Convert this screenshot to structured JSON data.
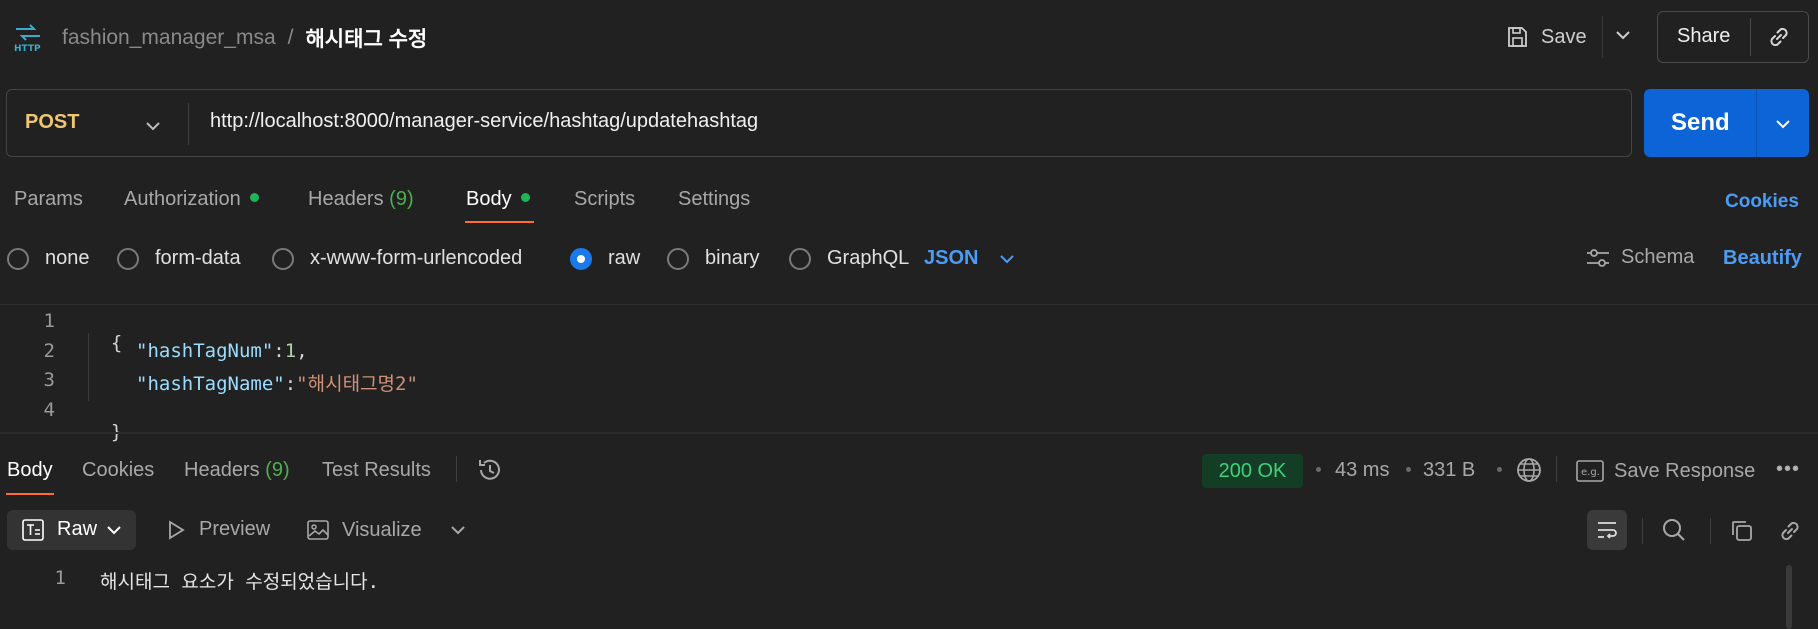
{
  "header": {
    "collection": "fashion_manager_msa",
    "separator": "/",
    "request_name": "해시태그 수정",
    "save_label": "Save",
    "share_label": "Share"
  },
  "request": {
    "method": "POST",
    "url": "http://localhost:8000/manager-service/hashtag/updatehashtag",
    "send_label": "Send"
  },
  "request_tabs": [
    {
      "label": "Params"
    },
    {
      "label": "Authorization"
    },
    {
      "label": "Headers",
      "count": "(9)"
    },
    {
      "label": "Body"
    },
    {
      "label": "Scripts"
    },
    {
      "label": "Settings"
    }
  ],
  "cookies_label": "Cookies",
  "body_types": [
    "none",
    "form-data",
    "x-www-form-urlencoded",
    "raw",
    "binary",
    "GraphQL"
  ],
  "body_type_selected": "raw",
  "body_format": "JSON",
  "schema_label": "Schema",
  "beautify_label": "Beautify",
  "editor": {
    "line_numbers": [
      "1",
      "2",
      "3",
      "4"
    ],
    "open_brace": "{",
    "close_brace": "}",
    "key1": "\"hashTagNum\"",
    "colon1": ":",
    "val1": "1",
    "comma1": ",",
    "key2": "\"hashTagName\"",
    "colon2": ":",
    "val2": "\"해시태그명2\""
  },
  "response_tabs": [
    {
      "label": "Body"
    },
    {
      "label": "Cookies"
    },
    {
      "label": "Headers",
      "count": "(9)"
    },
    {
      "label": "Test Results"
    }
  ],
  "response_meta": {
    "status": "200 OK",
    "time": "43 ms",
    "size": "331 B",
    "save_response_label": "Save Response",
    "more": "•••"
  },
  "response_toolbar": {
    "raw_label": "Raw",
    "preview_label": "Preview",
    "visualize_label": "Visualize"
  },
  "response_body": {
    "line_number": "1",
    "text": "해시태그 요소가 수정되었습니다."
  },
  "colors": {
    "accent": "#ff6c37",
    "send": "#0d64d6",
    "link": "#4b9cf5",
    "status_ok": "#3fd07a",
    "method": "#f0c674"
  }
}
